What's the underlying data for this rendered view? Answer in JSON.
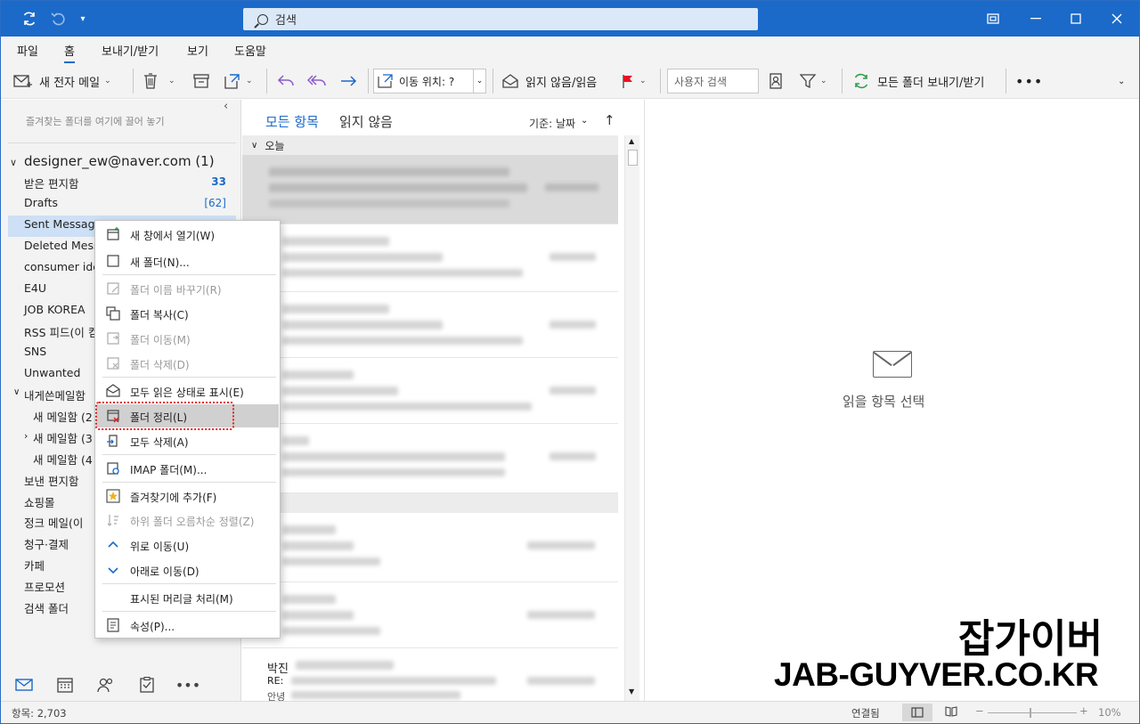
{
  "titlebar": {
    "search_placeholder": "검색",
    "accent": "#1b6ac9"
  },
  "menu_tabs": [
    "파일",
    "홈",
    "보내기/받기",
    "보기",
    "도움말"
  ],
  "ribbon": {
    "new_mail": "새 전자 메일",
    "move_to": "이동 위치: ?",
    "read_unread": "읽지 않음/읽음",
    "people_search": "사용자 검색",
    "send_receive_all": "모든 폴더 보내기/받기"
  },
  "folders": {
    "favorites_hint": "즐겨찾는 폴더를 여기에 끌어 놓기",
    "account": "designer_ew@naver.com (1)",
    "items": [
      {
        "label": "받은 편지함",
        "count": "33"
      },
      {
        "label": "Drafts",
        "count": "[62]"
      },
      {
        "label": "Sent Messag",
        "count": ""
      },
      {
        "label": "Deleted Mess",
        "count": ""
      },
      {
        "label": "consumer ide",
        "count": ""
      },
      {
        "label": "E4U",
        "count": ""
      },
      {
        "label": "JOB KOREA",
        "count": ""
      },
      {
        "label": "RSS 피드(이 컴",
        "count": ""
      },
      {
        "label": "SNS",
        "count": ""
      },
      {
        "label": "Unwanted",
        "count": ""
      },
      {
        "label": "내게쓴메일함",
        "count": ""
      },
      {
        "label": "새 메일함 (2",
        "count": ""
      },
      {
        "label": "새 메일함 (3",
        "count": ""
      },
      {
        "label": "새 메일함 (4",
        "count": ""
      },
      {
        "label": "보낸 편지함",
        "count": ""
      },
      {
        "label": "쇼핑몰",
        "count": ""
      },
      {
        "label": "정크 메일(이",
        "count": ""
      },
      {
        "label": "청구·결제",
        "count": ""
      },
      {
        "label": "카페",
        "count": ""
      },
      {
        "label": "프로모션",
        "count": ""
      },
      {
        "label": "검색 폴더",
        "count": ""
      }
    ]
  },
  "message_list": {
    "tab_all": "모든 항목",
    "tab_unread": "읽지 않음",
    "sort_label": "기준: 날짜",
    "group_today": "오늘",
    "group_yesterday": "제",
    "partial_sender": "박진",
    "partial_subject": "RE:",
    "partial_preview": "안녕"
  },
  "reading_pane": {
    "empty_text": "읽을 항목 선택"
  },
  "status": {
    "items_count": "항목: 2,703",
    "connection": "연결됨",
    "zoom": "10%"
  },
  "context_menu": [
    {
      "label": "새 창에서 열기(W)",
      "enabled": true,
      "icon": "new-window-icon"
    },
    {
      "label": "새 폴더(N)...",
      "enabled": true,
      "icon": "new-folder-icon"
    },
    {
      "label": "폴더 이름 바꾸기(R)",
      "enabled": false,
      "icon": "rename-folder-icon"
    },
    {
      "label": "폴더 복사(C)",
      "enabled": true,
      "icon": "copy-folder-icon"
    },
    {
      "label": "폴더 이동(M)",
      "enabled": false,
      "icon": "move-folder-icon"
    },
    {
      "label": "폴더 삭제(D)",
      "enabled": false,
      "icon": "delete-folder-icon"
    },
    {
      "label": "모두 읽은 상태로 표시(E)",
      "enabled": true,
      "icon": "mark-read-icon"
    },
    {
      "label": "폴더 정리(L)",
      "enabled": true,
      "icon": "clean-folder-icon"
    },
    {
      "label": "모두 삭제(A)",
      "enabled": true,
      "icon": "delete-all-icon"
    },
    {
      "label": "IMAP 폴더(M)...",
      "enabled": true,
      "icon": "imap-folder-icon"
    },
    {
      "label": "즐겨찾기에 추가(F)",
      "enabled": true,
      "icon": "favorite-star-icon"
    },
    {
      "label": "하위 폴더 오름차순 정렬(Z)",
      "enabled": false,
      "icon": "sort-ascending-icon"
    },
    {
      "label": "위로 이동(U)",
      "enabled": true,
      "icon": "chevron-up-icon"
    },
    {
      "label": "아래로 이동(D)",
      "enabled": true,
      "icon": "chevron-down-icon"
    },
    {
      "label": "표시된 머리글 처리(M)",
      "enabled": true,
      "icon": ""
    },
    {
      "label": "속성(P)...",
      "enabled": true,
      "icon": "properties-icon"
    }
  ],
  "watermark": {
    "line1": "잡가이버",
    "line2": "JAB-GUYVER.CO.KR"
  }
}
